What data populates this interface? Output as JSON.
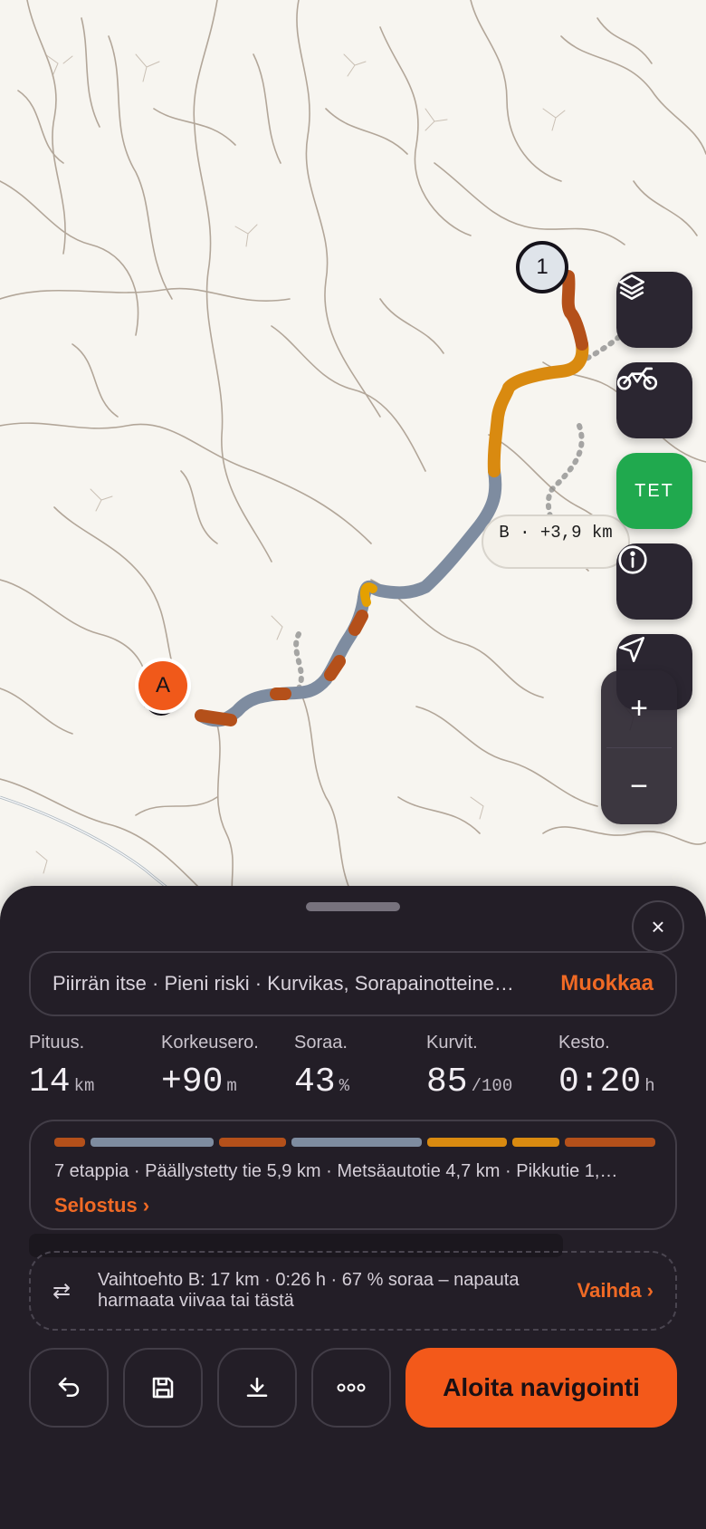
{
  "map": {
    "waypoint_1_label": "1",
    "start_marker_label": "A",
    "alt_route_label": "B · +3,9 km",
    "side_buttons": [
      {
        "name": "layers-icon"
      },
      {
        "name": "motorcycle-icon"
      },
      {
        "name": "mode-badge",
        "label": "TET"
      },
      {
        "name": "info-icon"
      },
      {
        "name": "navigation-arrow-icon"
      }
    ],
    "zoom_in": "+",
    "zoom_out": "−",
    "colors": {
      "paved": "#7e8ca0",
      "gravel": "#d98a10",
      "trail": "#b4501a",
      "water": "#ffffff"
    }
  },
  "sheet": {
    "close_icon": "×",
    "summary": "Piirrän itse · Pieni riski · Kurvikas, Sorapainotteine…",
    "edit_label": "Muokkaa",
    "stats": [
      {
        "label": "Pituus.",
        "value": "14",
        "unit": "km"
      },
      {
        "label": "Korkeusero.",
        "value": "+90",
        "unit": "m"
      },
      {
        "label": "Soraa.",
        "value": "43",
        "unit": "%"
      },
      {
        "label": "Kurvit.",
        "value": "85",
        "unit": "/100"
      },
      {
        "label": "Kesto.",
        "value": "0:20",
        "unit": "h"
      }
    ],
    "stages_text": "7 etappia · Päällystetty tie 5,9 km · Metsäautotie 4,7 km · Pikkutie 1,…",
    "report_link": "Selostus ›",
    "alternative_text": "Vaihtoehto B: 17 km · 0:26 h · 67 % soraa – napauta harmaata viivaa tai tästä",
    "swap_link": "Vaihda ›",
    "start_button": "Aloita navigointi",
    "accent_color": "#f3591a"
  }
}
